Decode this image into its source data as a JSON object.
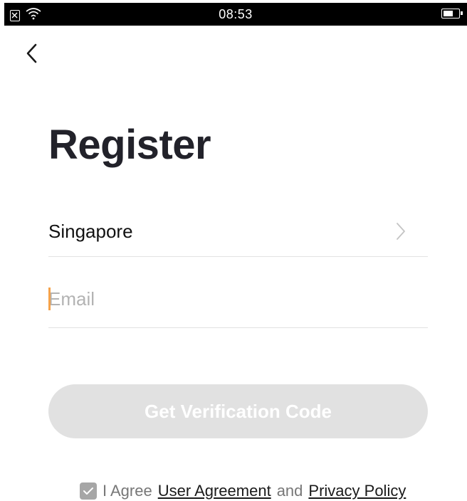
{
  "status_bar": {
    "time": "08:53"
  },
  "header": {
    "back_icon": "chevron-left-icon"
  },
  "page": {
    "title": "Register"
  },
  "form": {
    "country": {
      "value": "Singapore",
      "icon": "chevron-right-icon"
    },
    "email": {
      "value": "",
      "placeholder": "Email"
    },
    "submit_label": "Get Verification Code"
  },
  "agreement": {
    "checked": true,
    "prefix": "I Agree",
    "user_agreement_label": "User Agreement",
    "conjunction": "and",
    "privacy_policy_label": "Privacy Policy"
  },
  "colors": {
    "caret": "#f5a24a",
    "button_disabled": "#e1e1e1",
    "title": "#22222a"
  }
}
